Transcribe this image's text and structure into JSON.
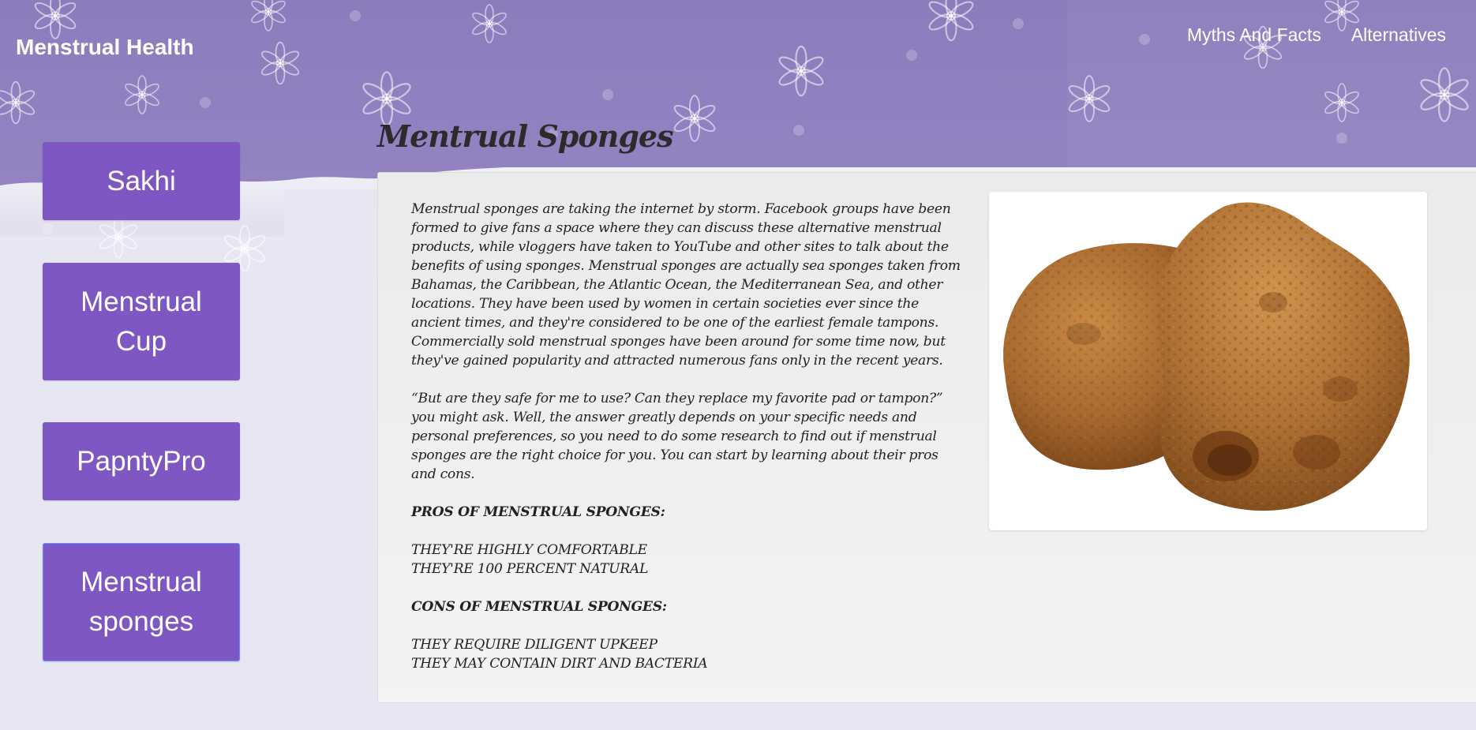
{
  "brand": "Menstrual Health",
  "nav": {
    "myths": "Myths And Facts",
    "alternatives": "Alternatives"
  },
  "sidebar": {
    "items": [
      {
        "label": "Sakhi"
      },
      {
        "label": "Menstrual Cup"
      },
      {
        "label": "PapntyPro"
      },
      {
        "label": "Menstrual sponges",
        "active": true
      }
    ]
  },
  "page_title": "Mentrual Sponges",
  "content": {
    "paragraph1": "Menstrual sponges are taking the internet by storm. Facebook groups have been formed to give fans a space where they can discuss these alternative menstrual products, while vloggers have taken to YouTube and other sites to talk about the benefits of using sponges. Menstrual sponges are actually sea sponges taken from Bahamas, the Caribbean, the Atlantic Ocean, the Mediterranean Sea, and other locations. They have been used by women in certain societies ever since the ancient times, and they're considered to be one of the earliest female tampons. Commercially sold menstrual sponges have been around for some time now, but they've gained popularity and attracted numerous fans only in the recent years.",
    "paragraph2": "“But are they safe for me to use? Can they replace my favorite pad or tampon?” you might ask. Well, the answer greatly depends on your specific needs and personal preferences, so you need to do some research to find out if menstrual sponges are the right choice for you. You can start by learning about their pros and cons.",
    "pros_heading": "PROS OF MENSTRUAL SPONGES:",
    "pros": [
      "THEY'RE HIGHLY COMFORTABLE",
      "THEY'RE 100 PERCENT NATURAL"
    ],
    "cons_heading": "CONS OF MENSTRUAL SPONGES:",
    "cons": [
      "THEY REQUIRE DILIGENT UPKEEP",
      "THEY MAY CONTAIN DIRT AND BACTERIA"
    ]
  },
  "colors": {
    "header_purple": "#8f7fbf",
    "button_purple": "#7e57c2",
    "page_bg": "#e7e7f4",
    "sponge_brown": "#a8692f"
  }
}
